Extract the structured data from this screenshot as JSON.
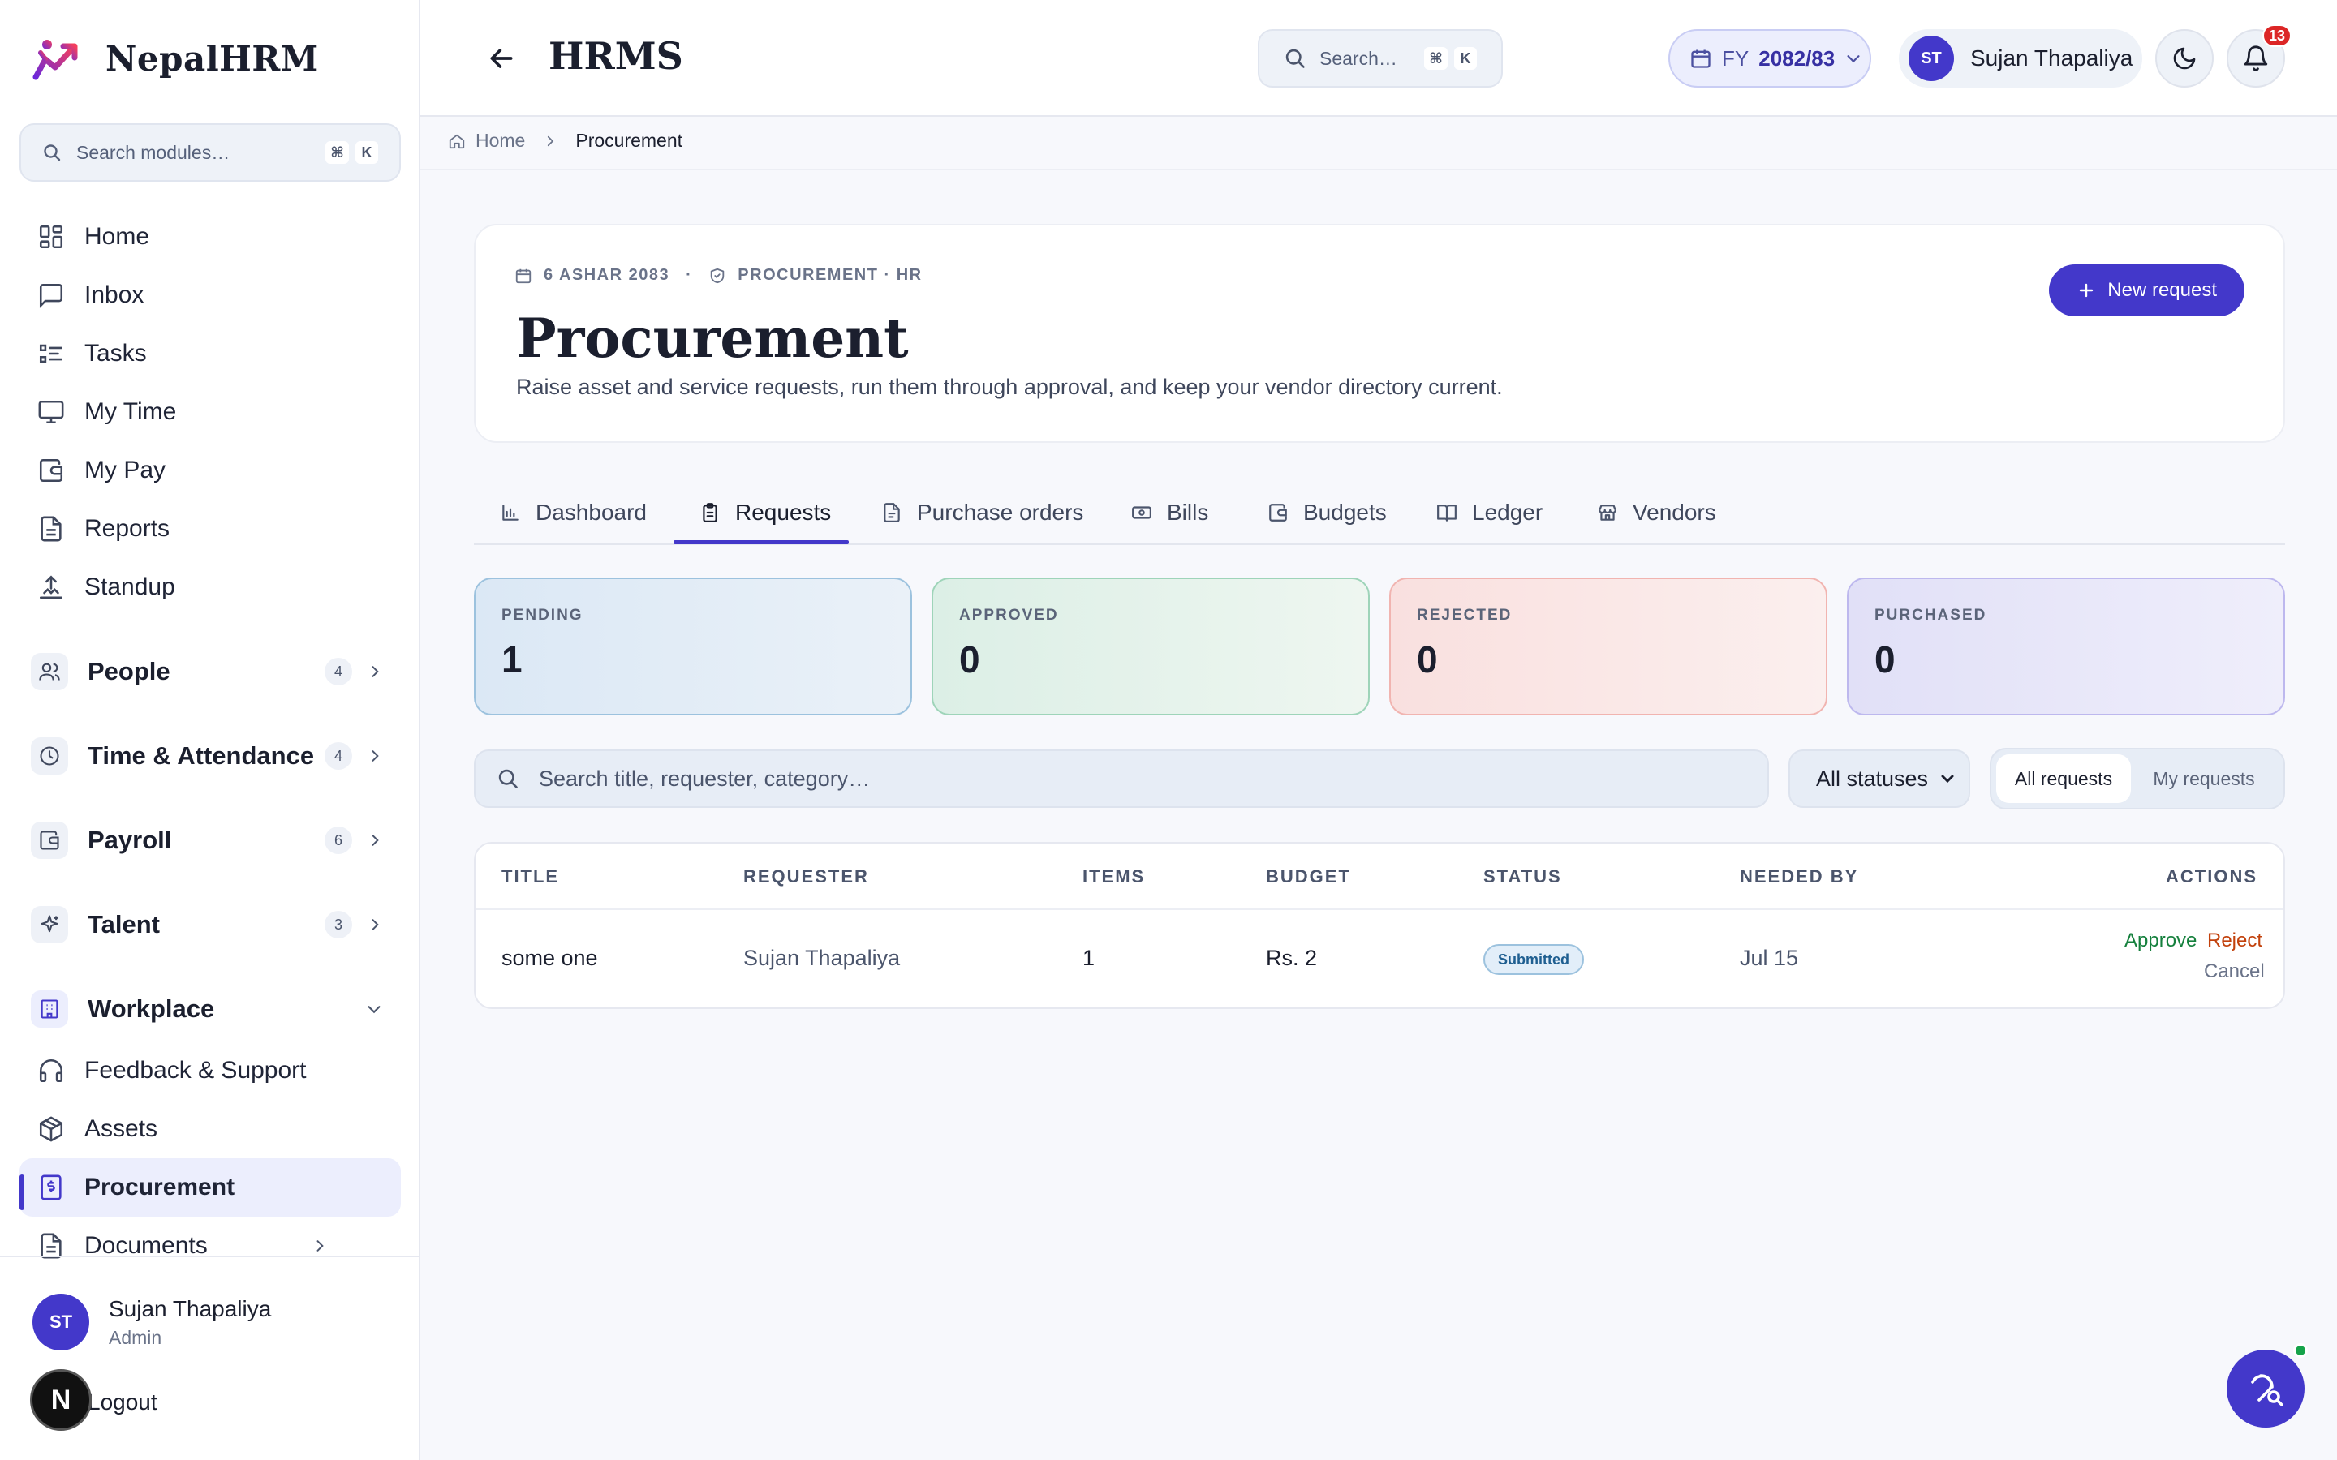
{
  "brand": {
    "name": "NepalHRM"
  },
  "sidebar": {
    "search_placeholder": "Search modules…",
    "shortcut": [
      "⌘",
      "K"
    ],
    "items": [
      {
        "label": "Home",
        "icon": "grid-icon"
      },
      {
        "label": "Inbox",
        "icon": "message-square-icon"
      },
      {
        "label": "Tasks",
        "icon": "list-checks-icon"
      },
      {
        "label": "My Time",
        "icon": "monitor-icon"
      },
      {
        "label": "My Pay",
        "icon": "wallet-icon"
      },
      {
        "label": "Reports",
        "icon": "file-text-icon"
      },
      {
        "label": "Standup",
        "icon": "standup-icon"
      }
    ],
    "groups": [
      {
        "label": "People",
        "count": "4",
        "icon": "users-icon"
      },
      {
        "label": "Time & Attendance",
        "count": "4",
        "icon": "clock-icon"
      },
      {
        "label": "Payroll",
        "count": "6",
        "icon": "wallet-icon"
      },
      {
        "label": "Talent",
        "count": "3",
        "icon": "sparkles-icon"
      },
      {
        "label": "Workplace",
        "icon": "building-icon"
      }
    ],
    "workplace_items": [
      {
        "label": "Feedback & Support",
        "icon": "headphones-icon"
      },
      {
        "label": "Assets",
        "icon": "package-icon"
      },
      {
        "label": "Procurement",
        "icon": "receipt-icon",
        "active": true
      },
      {
        "label": "Documents",
        "icon": "file-text-icon"
      }
    ],
    "footer": {
      "initials": "ST",
      "name": "Sujan Thapaliya",
      "role": "Admin",
      "logout": "Logout",
      "badge": "N"
    }
  },
  "topbar": {
    "title": "HRMS",
    "search_placeholder": "Search…",
    "shortcut": [
      "⌘",
      "K"
    ],
    "fy_label": "FY",
    "fy_value": "2082/83",
    "user_initials": "ST",
    "user_name": "Sujan Thapaliya",
    "notifications": "13"
  },
  "breadcrumb": {
    "home": "Home",
    "current": "Procurement"
  },
  "header": {
    "date": "6 ASHAR 2083",
    "separator": "·",
    "scope": "PROCUREMENT · HR",
    "title": "Procurement",
    "subtitle": "Raise asset and service requests, run them through approval, and keep your vendor directory current.",
    "new_request": "New request"
  },
  "tabs": [
    {
      "label": "Dashboard",
      "icon": "bar-chart-icon"
    },
    {
      "label": "Requests",
      "icon": "clipboard-icon",
      "active": true
    },
    {
      "label": "Purchase orders",
      "icon": "file-icon"
    },
    {
      "label": "Bills",
      "icon": "banknote-icon"
    },
    {
      "label": "Budgets",
      "icon": "wallet-icon"
    },
    {
      "label": "Ledger",
      "icon": "book-open-icon"
    },
    {
      "label": "Vendors",
      "icon": "store-icon"
    }
  ],
  "stats": [
    {
      "label": "PENDING",
      "value": "1"
    },
    {
      "label": "APPROVED",
      "value": "0"
    },
    {
      "label": "REJECTED",
      "value": "0"
    },
    {
      "label": "PURCHASED",
      "value": "0"
    }
  ],
  "filters": {
    "search_placeholder": "Search title, requester, category…",
    "status_selected": "All statuses",
    "scope_options": [
      "All requests",
      "My requests"
    ]
  },
  "table": {
    "columns": [
      "TITLE",
      "REQUESTER",
      "ITEMS",
      "BUDGET",
      "STATUS",
      "NEEDED BY",
      "ACTIONS"
    ],
    "rows": [
      {
        "title": "some one",
        "requester": "Sujan Thapaliya",
        "items": "1",
        "budget": "Rs. 2",
        "status": "Submitted",
        "needed_by": "Jul 15",
        "actions": [
          "Approve",
          "Reject",
          "Cancel"
        ]
      }
    ]
  },
  "colors": {
    "accent": "#4338ca",
    "approve": "#15803d",
    "reject": "#c2410c",
    "notification": "#dc2626"
  }
}
